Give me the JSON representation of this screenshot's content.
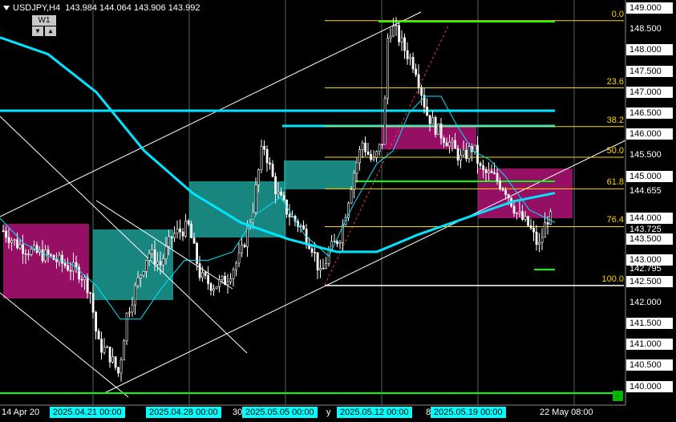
{
  "header": {
    "symbol_tf": "USDJPY,H4",
    "ohlc": "143.984 144.064 143.906 143.992"
  },
  "wbox": {
    "label": "W1",
    "down": "▼",
    "up": "▲"
  },
  "price_labels": [
    {
      "text": "149.000",
      "price": 149.0,
      "box": true
    },
    {
      "text": "148.500",
      "price": 148.5,
      "box": false
    },
    {
      "text": "148.000",
      "price": 148.0,
      "box": true
    },
    {
      "text": "147.500",
      "price": 147.5,
      "box": true
    },
    {
      "text": "147.000",
      "price": 147.0,
      "box": true
    },
    {
      "text": "146.500",
      "price": 146.5,
      "box": true
    },
    {
      "text": "146.000",
      "price": 146.0,
      "box": true
    },
    {
      "text": "145.500",
      "price": 145.5,
      "box": false
    },
    {
      "text": "145.000",
      "price": 145.0,
      "box": true
    },
    {
      "text": "144.655",
      "price": 144.655,
      "box": false
    },
    {
      "text": "144.000",
      "price": 144.0,
      "box": true
    },
    {
      "text": "143.725",
      "price": 143.725,
      "box": false
    },
    {
      "text": "143.500",
      "price": 143.5,
      "box": true
    },
    {
      "text": "143.000",
      "price": 143.0,
      "box": true
    },
    {
      "text": "142.795",
      "price": 142.795,
      "box": false
    },
    {
      "text": "142.500",
      "price": 142.5,
      "box": true
    },
    {
      "text": "142.000",
      "price": 142.0,
      "box": false
    },
    {
      "text": "141.500",
      "price": 141.5,
      "box": true
    },
    {
      "text": "141.000",
      "price": 141.0,
      "box": true
    },
    {
      "text": "140.500",
      "price": 140.5,
      "box": true
    },
    {
      "text": "140.000",
      "price": 140.0,
      "box": true
    }
  ],
  "fib_levels": [
    {
      "label": "0.0",
      "price": 148.7
    },
    {
      "label": "23.6",
      "price": 147.1
    },
    {
      "label": "38.2",
      "price": 146.18
    },
    {
      "label": "50.0",
      "price": 145.45
    },
    {
      "label": "61.8",
      "price": 144.7
    },
    {
      "label": "76.4",
      "price": 143.8
    },
    {
      "label": "100.0",
      "price": 142.4
    }
  ],
  "time_labels": [
    {
      "text": "14 Apr 20",
      "box": false
    },
    {
      "text": "2025.04.21 00:00",
      "box": true
    },
    {
      "text": "2025.04.28 00:00",
      "box": true
    },
    {
      "text": "30",
      "box": false
    },
    {
      "text": "2025.05.05 00:00",
      "box": true
    },
    {
      "text": "y",
      "box": false
    },
    {
      "text": "2025.05.12 00:00",
      "box": true
    },
    {
      "text": "8",
      "box": false
    },
    {
      "text": "2025.05.19 00:00",
      "box": true
    },
    {
      "text": "22 May 08:00",
      "box": false
    }
  ],
  "corner_button": "-",
  "colors": {
    "background": "#000000",
    "candle": "#ffffff",
    "grid": "#2f4f4f",
    "ma_thick": "#00e5ff",
    "ma_thin": "#00e5ff",
    "fib": "#ffd700",
    "green_line": "#00ff00",
    "zone_teal": "#20b2aa",
    "zone_magenta": "#c71585"
  }
}
